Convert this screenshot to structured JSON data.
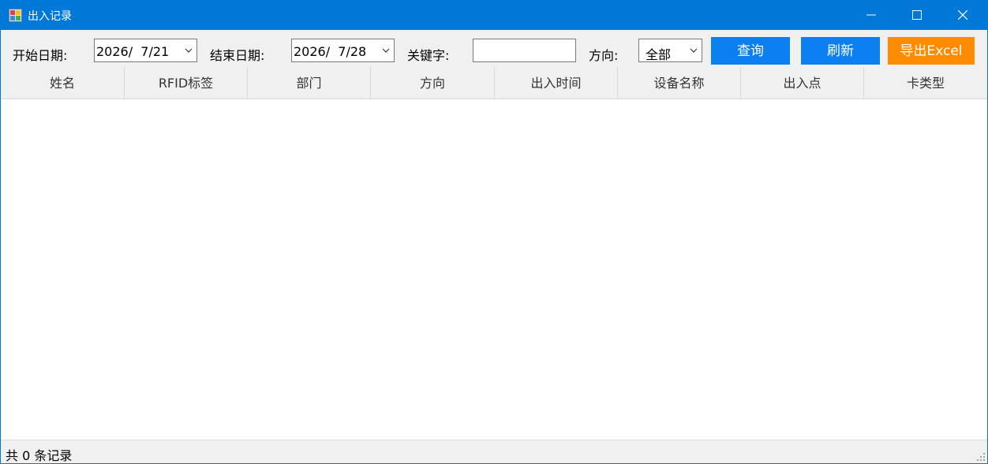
{
  "window": {
    "title": "出入记录",
    "icon": "app-window-icon",
    "controls": [
      "minimize-icon",
      "maximize-icon",
      "close-icon"
    ]
  },
  "toolbar": {
    "start_label": "开始日期:",
    "start_date": "2026/  7/21",
    "end_label": "结束日期:",
    "end_date": "2026/  7/28",
    "keyword_label": "关键字:",
    "keyword_value": "",
    "direction_label": "方向:",
    "direction_value": "全部",
    "query_button": "查询",
    "refresh_button": "刷新",
    "export_button": "导出Excel"
  },
  "table": {
    "columns": [
      "姓名",
      "RFID标签",
      "部门",
      "方向",
      "出入时间",
      "设备名称",
      "出入点",
      "卡类型"
    ],
    "rows": []
  },
  "status": {
    "text": "共 0 条记录"
  },
  "colors": {
    "titlebar": "#0078d7",
    "button_blue": "#0a7ff0",
    "button_orange": "#ff8c00"
  }
}
